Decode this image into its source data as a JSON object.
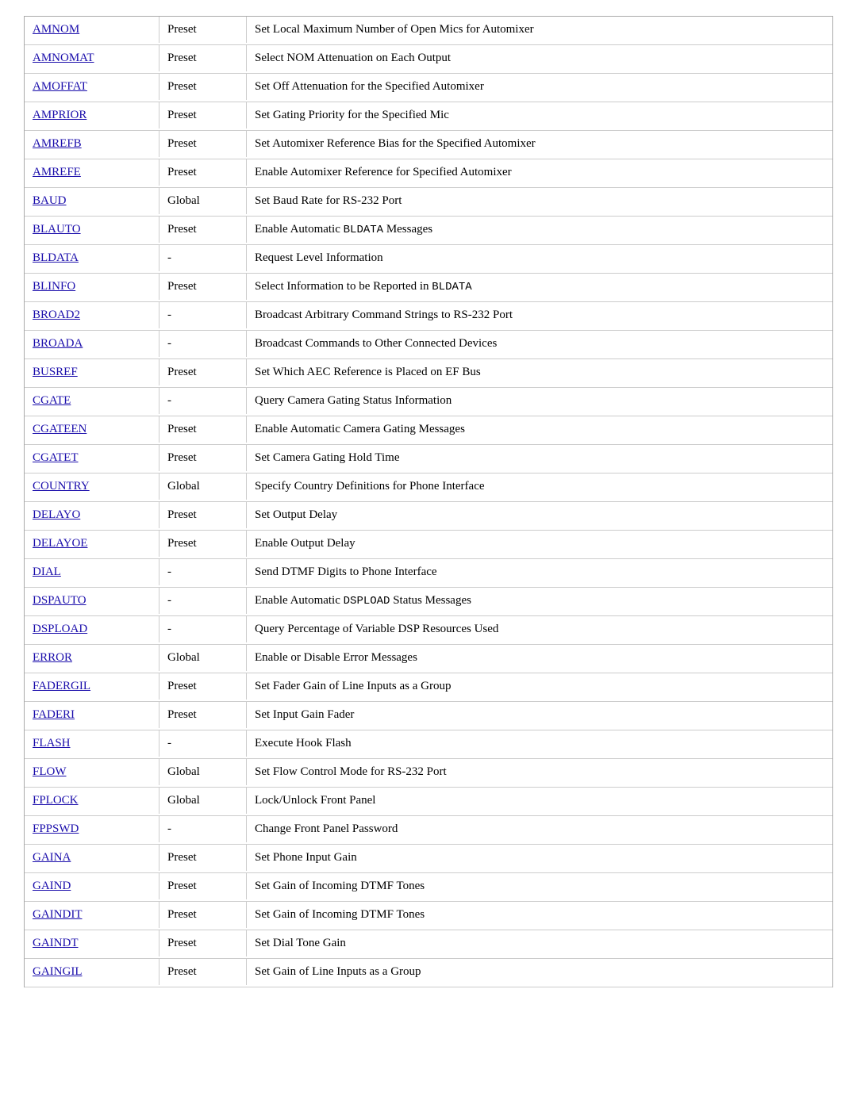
{
  "rows": [
    {
      "name": "AMNOM",
      "type": "Preset",
      "desc": "Set Local Maximum Number of Open Mics for Automixer"
    },
    {
      "name": "AMNOMAT",
      "type": "Preset",
      "desc": "Select NOM Attenuation on Each Output"
    },
    {
      "name": "AMOFFAT",
      "type": "Preset",
      "desc": "Set Off Attenuation for the Specified Automixer"
    },
    {
      "name": "AMPRIOR",
      "type": "Preset",
      "desc": "Set Gating Priority for the Specified Mic"
    },
    {
      "name": "AMREFB",
      "type": "Preset",
      "desc": "Set Automixer Reference Bias for the Specified Automixer"
    },
    {
      "name": "AMREFE",
      "type": "Preset",
      "desc": "Enable Automixer Reference for Specified Automixer"
    },
    {
      "name": "BAUD",
      "type": "Global",
      "desc": "Set Baud Rate for RS-232 Port"
    },
    {
      "name": "BLAUTO",
      "type": "Preset",
      "desc": "Enable Automatic BLDATA Messages",
      "desc_mono": "BLDATA"
    },
    {
      "name": "BLDATA",
      "type": "-",
      "desc": "Request Level Information"
    },
    {
      "name": "BLINFO",
      "type": "Preset",
      "desc": "Select Information to be Reported in BLDATA",
      "desc_mono": "BLDATA"
    },
    {
      "name": "BROAD2",
      "type": "-",
      "desc": "Broadcast Arbitrary Command Strings to RS-232 Port"
    },
    {
      "name": "BROADA",
      "type": "-",
      "desc": "Broadcast Commands to Other Connected Devices"
    },
    {
      "name": "BUSREF",
      "type": "Preset",
      "desc": "Set Which AEC Reference is Placed on EF Bus"
    },
    {
      "name": "CGATE",
      "type": "-",
      "desc": "Query Camera Gating Status Information"
    },
    {
      "name": "CGATEEN",
      "type": "Preset",
      "desc": "Enable Automatic Camera Gating Messages"
    },
    {
      "name": "CGATET",
      "type": "Preset",
      "desc": "Set Camera Gating Hold Time"
    },
    {
      "name": "COUNTRY",
      "type": "Global",
      "desc": "Specify Country Definitions for Phone Interface"
    },
    {
      "name": "DELAYO",
      "type": "Preset",
      "desc": "Set Output Delay"
    },
    {
      "name": "DELAYOE",
      "type": "Preset",
      "desc": "Enable Output Delay"
    },
    {
      "name": "DIAL",
      "type": "-",
      "desc": "Send DTMF Digits to Phone Interface"
    },
    {
      "name": "DSPAUTO",
      "type": "-",
      "desc": "Enable Automatic DSPLOAD Status Messages",
      "desc_mono": "DSPLOAD"
    },
    {
      "name": "DSPLOAD",
      "type": "-",
      "desc": "Query Percentage of Variable DSP Resources Used"
    },
    {
      "name": "ERROR",
      "type": "Global",
      "desc": "Enable or Disable Error Messages"
    },
    {
      "name": "FADERGIL",
      "type": "Preset",
      "desc": "Set Fader Gain of Line Inputs as a Group"
    },
    {
      "name": "FADERI",
      "type": "Preset",
      "desc": "Set Input Gain Fader"
    },
    {
      "name": "FLASH",
      "type": "-",
      "desc": "Execute Hook Flash"
    },
    {
      "name": "FLOW",
      "type": "Global",
      "desc": "Set Flow Control Mode for RS-232 Port"
    },
    {
      "name": "FPLOCK",
      "type": "Global",
      "desc": "Lock/Unlock Front Panel"
    },
    {
      "name": "FPPSWD",
      "type": "-",
      "desc": "Change Front Panel Password"
    },
    {
      "name": "GAINA",
      "type": "Preset",
      "desc": "Set Phone Input Gain"
    },
    {
      "name": "GAIND",
      "type": "Preset",
      "desc": "Set Gain of Incoming DTMF Tones"
    },
    {
      "name": "GAINDIT",
      "type": "Preset",
      "desc": "Set Gain of Incoming DTMF Tones"
    },
    {
      "name": "GAINDT",
      "type": "Preset",
      "desc": "Set Dial Tone Gain"
    },
    {
      "name": "GAINGIL",
      "type": "Preset",
      "desc": "Set Gain of Line Inputs as a Group"
    }
  ]
}
